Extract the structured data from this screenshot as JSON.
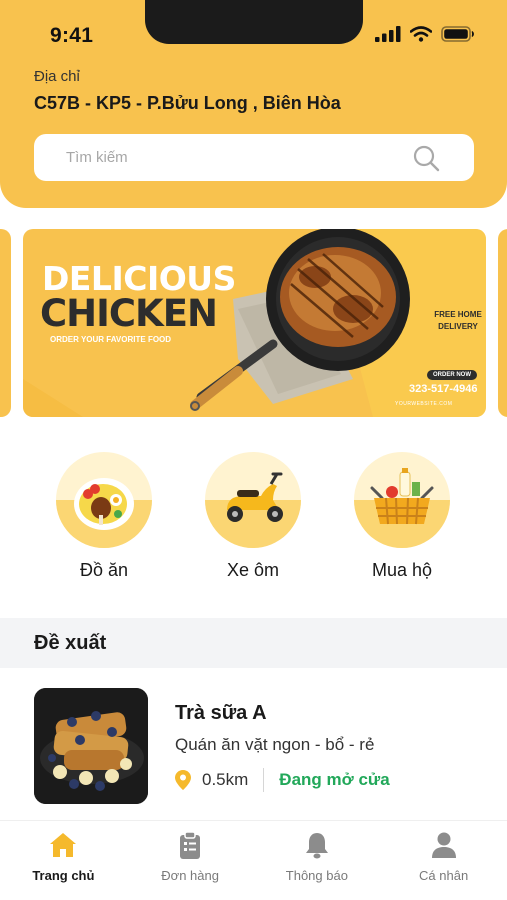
{
  "status_bar": {
    "time": "9:41"
  },
  "header": {
    "address_label": "Địa chỉ",
    "address_value": "C57B - KP5 - P.Bửu Long , Biên Hòa",
    "search_placeholder": "Tìm kiếm",
    "accent_color": "#f8c24e"
  },
  "banner": {
    "title_line1": "DELICIOUS",
    "title_line2": "CHICKEN",
    "subtitle": "ORDER YOUR FAVORITE FOOD",
    "free_delivery": "FREE HOME DELIVERY",
    "order_now": "ORDER NOW",
    "phone": "323-517-4946",
    "website": "YOURWEBSITE.COM"
  },
  "categories": [
    {
      "label": "Đồ ăn",
      "icon": "food-plate-icon"
    },
    {
      "label": "Xe ôm",
      "icon": "scooter-icon"
    },
    {
      "label": "Mua hộ",
      "icon": "shopping-basket-icon"
    }
  ],
  "section": {
    "title": "Đề xuất"
  },
  "recommendation": {
    "name": "Trà sữa A",
    "description": "Quán ăn vặt ngon - bổ - rẻ",
    "distance": "0.5km",
    "status": "Đang mở cửa",
    "status_color": "#22a85a"
  },
  "tabbar": {
    "items": [
      {
        "label": "Trang chủ",
        "icon": "home-icon",
        "active": true
      },
      {
        "label": "Đơn hàng",
        "icon": "clipboard-icon",
        "active": false
      },
      {
        "label": "Thông báo",
        "icon": "bell-icon",
        "active": false
      },
      {
        "label": "Cá nhân",
        "icon": "user-icon",
        "active": false
      }
    ]
  }
}
